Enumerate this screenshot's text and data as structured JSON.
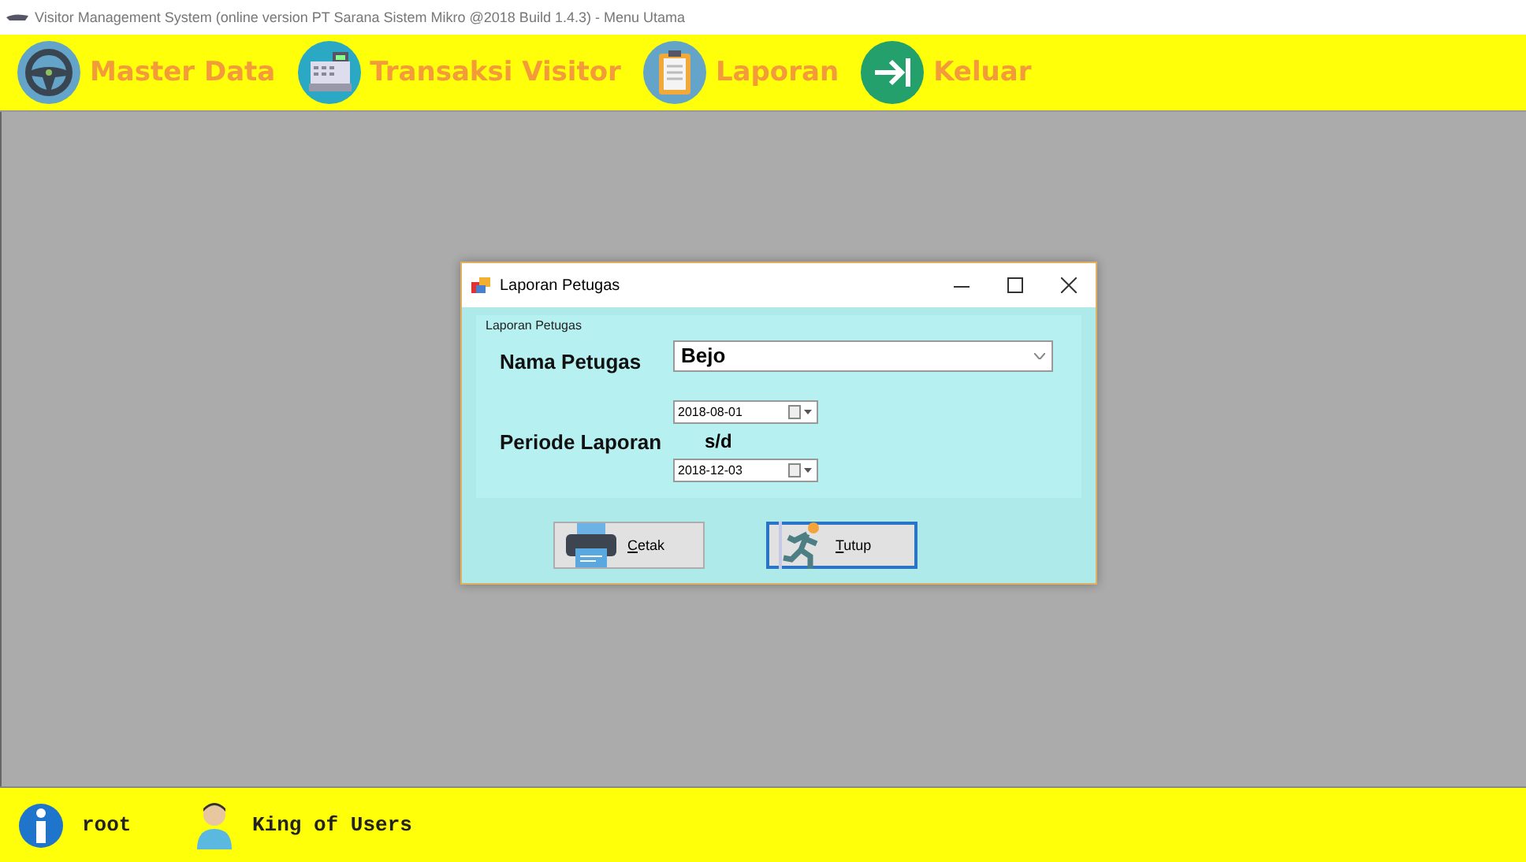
{
  "window": {
    "title": "Visitor Management System (online version PT Sarana Sistem Mikro @2018 Build 1.4.3) - Menu Utama"
  },
  "toolbar": [
    {
      "label": "Master Data",
      "kind": "wheel"
    },
    {
      "label": "Transaksi Visitor",
      "kind": "register"
    },
    {
      "label": "Laporan",
      "kind": "clipboard"
    },
    {
      "label": "Keluar",
      "kind": "exit"
    }
  ],
  "dialog": {
    "title": "Laporan Petugas",
    "group_label": "Laporan Petugas",
    "petugas_label": "Nama Petugas",
    "petugas_value": "Bejo",
    "periode_label": "Periode Laporan",
    "date_from": "2018-08-01",
    "separator": "s/d",
    "date_to": "2018-12-03",
    "buttons": [
      {
        "label": "Cetak",
        "kind": "print",
        "focused": false
      },
      {
        "label": "Tutup",
        "kind": "exit",
        "focused": true
      }
    ]
  },
  "status_bar": {
    "user": "root",
    "role": "King of Users"
  }
}
